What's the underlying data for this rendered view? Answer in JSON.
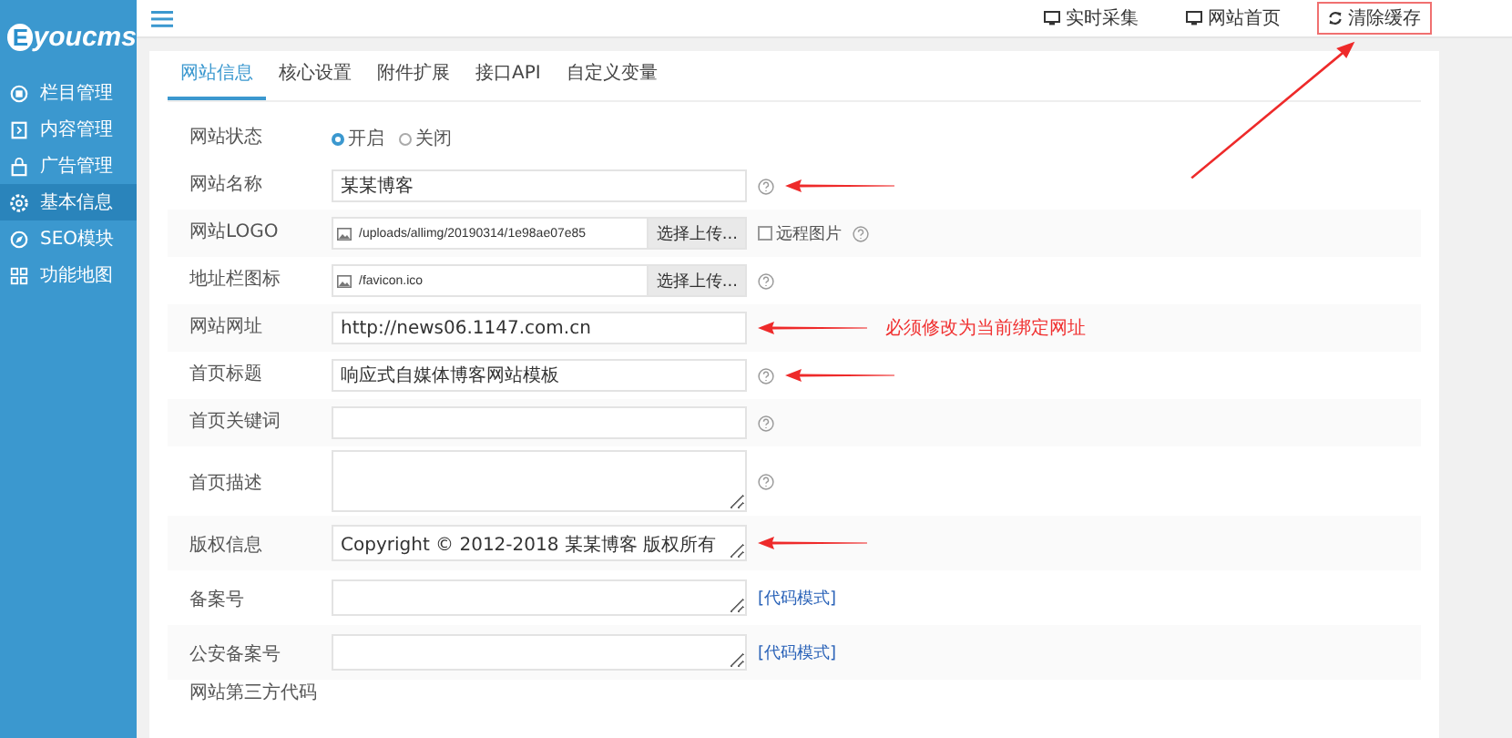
{
  "logo": {
    "badge": "E",
    "text": "youcms"
  },
  "sidebar": {
    "items": [
      {
        "label": "栏目管理",
        "selected": false
      },
      {
        "label": "内容管理",
        "selected": false
      },
      {
        "label": "广告管理",
        "selected": false
      },
      {
        "label": "基本信息",
        "selected": true
      },
      {
        "label": "SEO模块",
        "selected": false
      },
      {
        "label": "功能地图",
        "selected": false
      }
    ]
  },
  "top_links": [
    {
      "label": "实时采集",
      "kind": "monitor",
      "highlighted": false
    },
    {
      "label": "网站首页",
      "kind": "monitor",
      "highlighted": false
    },
    {
      "label": "清除缓存",
      "kind": "refresh",
      "highlighted": true
    }
  ],
  "tabs": [
    {
      "label": "网站信息",
      "selected": true
    },
    {
      "label": "核心设置",
      "selected": false
    },
    {
      "label": "附件扩展",
      "selected": false
    },
    {
      "label": "接口API",
      "selected": false
    },
    {
      "label": "自定义变量",
      "selected": false
    }
  ],
  "fields": [
    {
      "kind": "radio",
      "label": "网站状态",
      "options": [
        {
          "label": "开启",
          "selected": true
        },
        {
          "label": "关闭",
          "selected": false
        }
      ]
    },
    {
      "kind": "text",
      "label": "网站名称",
      "value": "某某博客",
      "help": true,
      "arrow": true
    },
    {
      "kind": "upload",
      "label": "网站LOGO",
      "value": "/uploads/allimg/20190314/1e98ae07e85",
      "button": "选择上传...",
      "checkbox": {
        "label": "远程图片",
        "checked": false
      },
      "help": true
    },
    {
      "kind": "upload",
      "label": "地址栏图标",
      "value": "/favicon.ico",
      "button": "选择上传...",
      "help": true
    },
    {
      "kind": "text",
      "label": "网站网址",
      "value": "http://news06.1147.com.cn",
      "arrow": true,
      "note": "必须修改为当前绑定网址"
    },
    {
      "kind": "text",
      "label": "首页标题",
      "value": "响应式自媒体博客网站模板",
      "help": true,
      "arrow": true
    },
    {
      "kind": "text",
      "label": "首页关键词",
      "help": true
    },
    {
      "kind": "textarea",
      "label": "首页描述",
      "help": true
    },
    {
      "kind": "textarea",
      "label": "版权信息",
      "value": "Copyright © 2012-2018 某某博客 版权所有",
      "arrow": true
    },
    {
      "kind": "textarea",
      "label": "备案号",
      "link": "[代码模式]"
    },
    {
      "kind": "textarea",
      "label": "公安备案号",
      "link": "[代码模式]"
    },
    {
      "kind": "heading",
      "label": "网站第三方代码"
    }
  ]
}
